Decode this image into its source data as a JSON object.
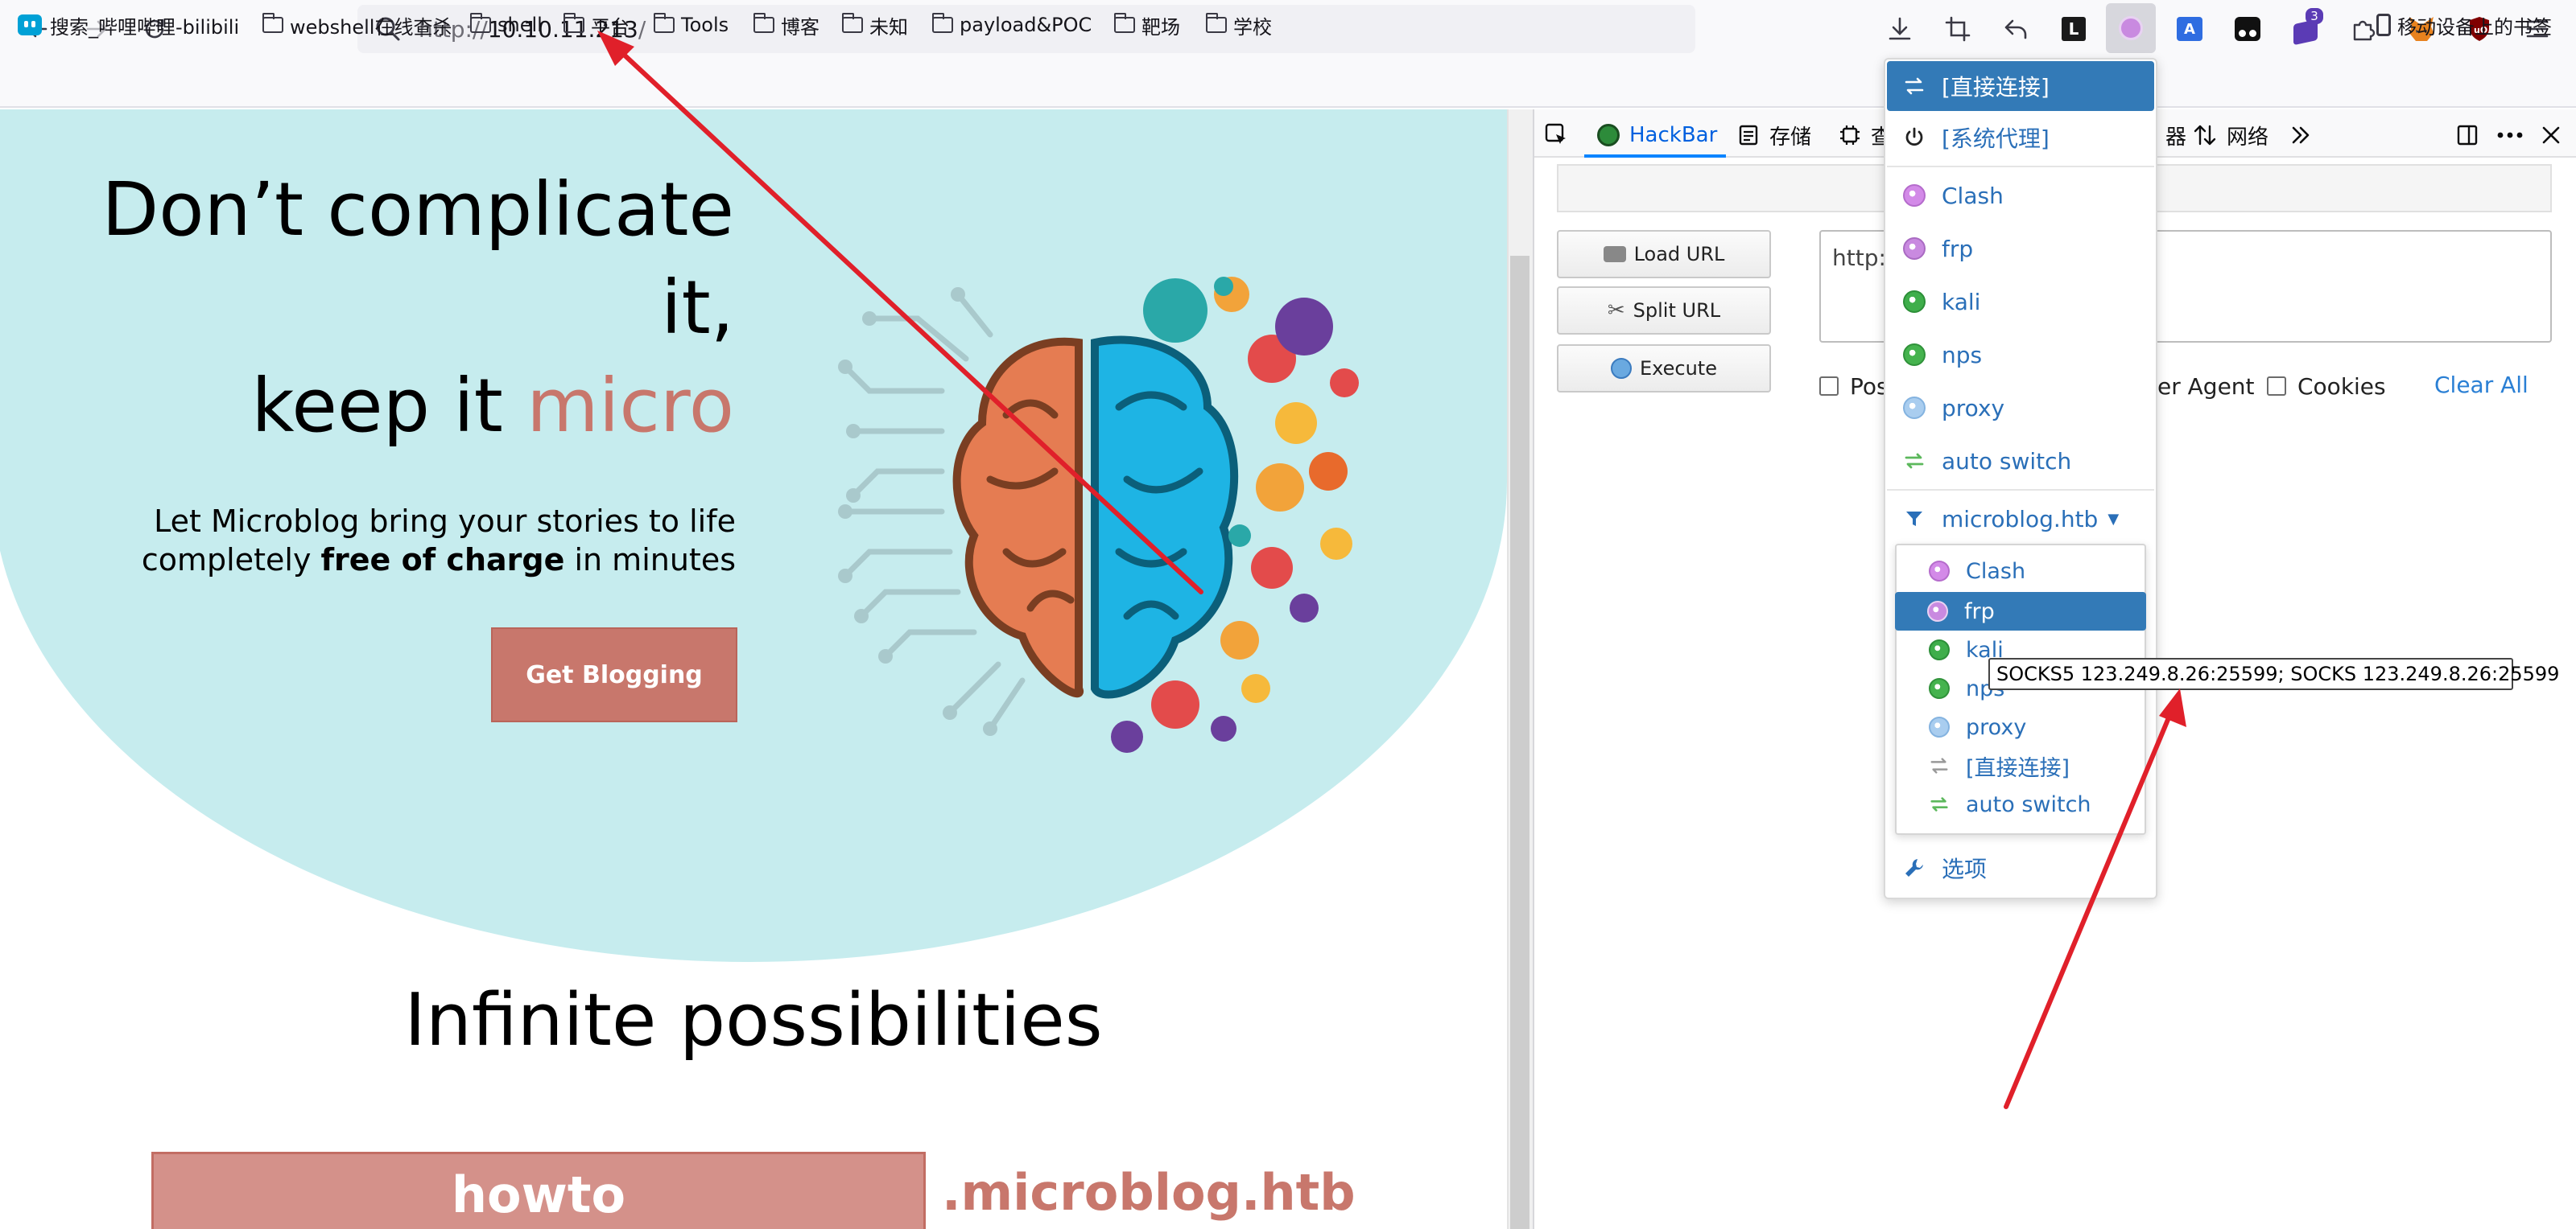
{
  "browser": {
    "url": {
      "proto": "http://",
      "host": "10.10.11.213",
      "tail": "/"
    },
    "extension_badge": "3"
  },
  "bookmarks": [
    {
      "label": "搜索_哔哩哔哩-bilibili",
      "type": "site"
    },
    {
      "label": "webshell在线查杀",
      "type": "folder"
    },
    {
      "label": "shell",
      "type": "folder"
    },
    {
      "label": "平台",
      "type": "folder"
    },
    {
      "label": "Tools",
      "type": "folder"
    },
    {
      "label": "博客",
      "type": "folder"
    },
    {
      "label": "未知",
      "type": "folder"
    },
    {
      "label": "payload&POC",
      "type": "folder"
    },
    {
      "label": "靶场",
      "type": "folder"
    },
    {
      "label": "学校",
      "type": "folder"
    }
  ],
  "mobile_bookmarks": "移动设备上的书签",
  "page": {
    "hero_line1": "Don’t complicate",
    "hero_line2": "it,",
    "hero_line3a": "keep it ",
    "hero_line3b": "micro",
    "sub_line1": "Let Microblog bring your stories to life",
    "sub_line2a": "completely ",
    "sub_line2b": "free of charge",
    "sub_line2c": " in minutes",
    "cta": "Get Blogging",
    "section_title": "Infinite possibilities",
    "howto": "howto",
    "howto_suffix": ".microblog.htb"
  },
  "devtools": {
    "tabs": {
      "hackbar": "HackBar",
      "storage": "存储",
      "other": "查",
      "net_prefix": "器",
      "network": "网络"
    },
    "hackbar": {
      "load_url": "Load URL",
      "split_url": "Split URL",
      "execute": "Execute",
      "textarea_value": "http://",
      "post_partial": "Pos",
      "useragent_partial": "er Agent",
      "cookies": "Cookies",
      "clear_all": "Clear All"
    }
  },
  "proxy_popup": {
    "direct": "[直接连接]",
    "system": "[系统代理]",
    "profiles": [
      {
        "name": "Clash",
        "color": "#d38ae8",
        "border": "#b56ccc"
      },
      {
        "name": "frp",
        "color": "#c98ae0",
        "border": "#a96bc2"
      },
      {
        "name": "kali",
        "color": "#3fae4b",
        "border": "#2c8f38"
      },
      {
        "name": "nps",
        "color": "#45b34e",
        "border": "#30923a"
      },
      {
        "name": "proxy",
        "color": "#a9cdef",
        "border": "#84b3e0"
      }
    ],
    "auto_switch": "auto switch",
    "current_rule": "microblog.htb",
    "submenu": [
      {
        "name": "Clash",
        "color": "#d38ae8",
        "border": "#b56ccc"
      },
      {
        "name": "frp",
        "color": "#c98ae0",
        "border": "#e8d2f2"
      },
      {
        "name": "kali",
        "color": "#3fae4b",
        "border": "#2c8f38"
      },
      {
        "name": "nps",
        "color": "#45b34e",
        "border": "#30923a"
      },
      {
        "name": "proxy",
        "color": "#a9cdef",
        "border": "#84b3e0"
      },
      {
        "name": "[直接连接]",
        "color": "#999999",
        "border": "#999999"
      },
      {
        "name": "auto switch",
        "color": "#5cb85c",
        "border": "#5cb85c"
      }
    ],
    "options": "选项",
    "tooltip": "SOCKS5 123.249.8.26:25599; SOCKS 123.249.8.26:25599"
  }
}
